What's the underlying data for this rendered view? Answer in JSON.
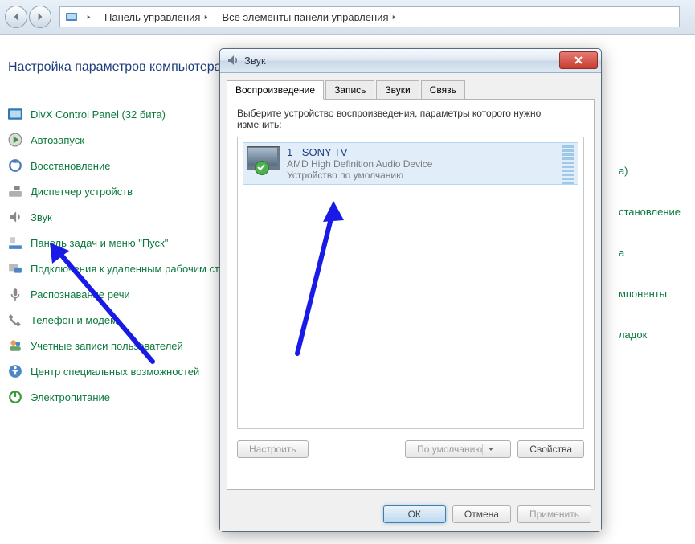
{
  "nav": {
    "breadcrumbs": [
      "Панель управления",
      "Все элементы панели управления"
    ]
  },
  "page": {
    "title": "Настройка параметров компьютера",
    "items": [
      "DivX Control Panel (32 бита)",
      "Автозапуск",
      "Восстановление",
      "Диспетчер устройств",
      "Звук",
      "Панель задач и меню \"Пуск\"",
      "Подключения к удаленным рабочим столам",
      "Распознавание речи",
      "Телефон и модем",
      "Учетные записи пользователей",
      "Центр специальных возможностей",
      "Электропитание"
    ],
    "rightItems": [
      "а)",
      "становление",
      "а",
      "мпоненты",
      "ладок"
    ]
  },
  "dialog": {
    "title": "Звук",
    "tabs": [
      "Воспроизведение",
      "Запись",
      "Звуки",
      "Связь"
    ],
    "activeTab": 0,
    "description": "Выберите устройство воспроизведения, параметры которого нужно изменить:",
    "device": {
      "name": "1 - SONY TV",
      "subtitle": "AMD High Definition Audio Device",
      "status": "Устройство по умолчанию"
    },
    "buttons": {
      "configure": "Настроить",
      "default": "По умолчанию",
      "properties": "Свойства",
      "ok": "ОК",
      "cancel": "Отмена",
      "apply": "Применить"
    }
  }
}
